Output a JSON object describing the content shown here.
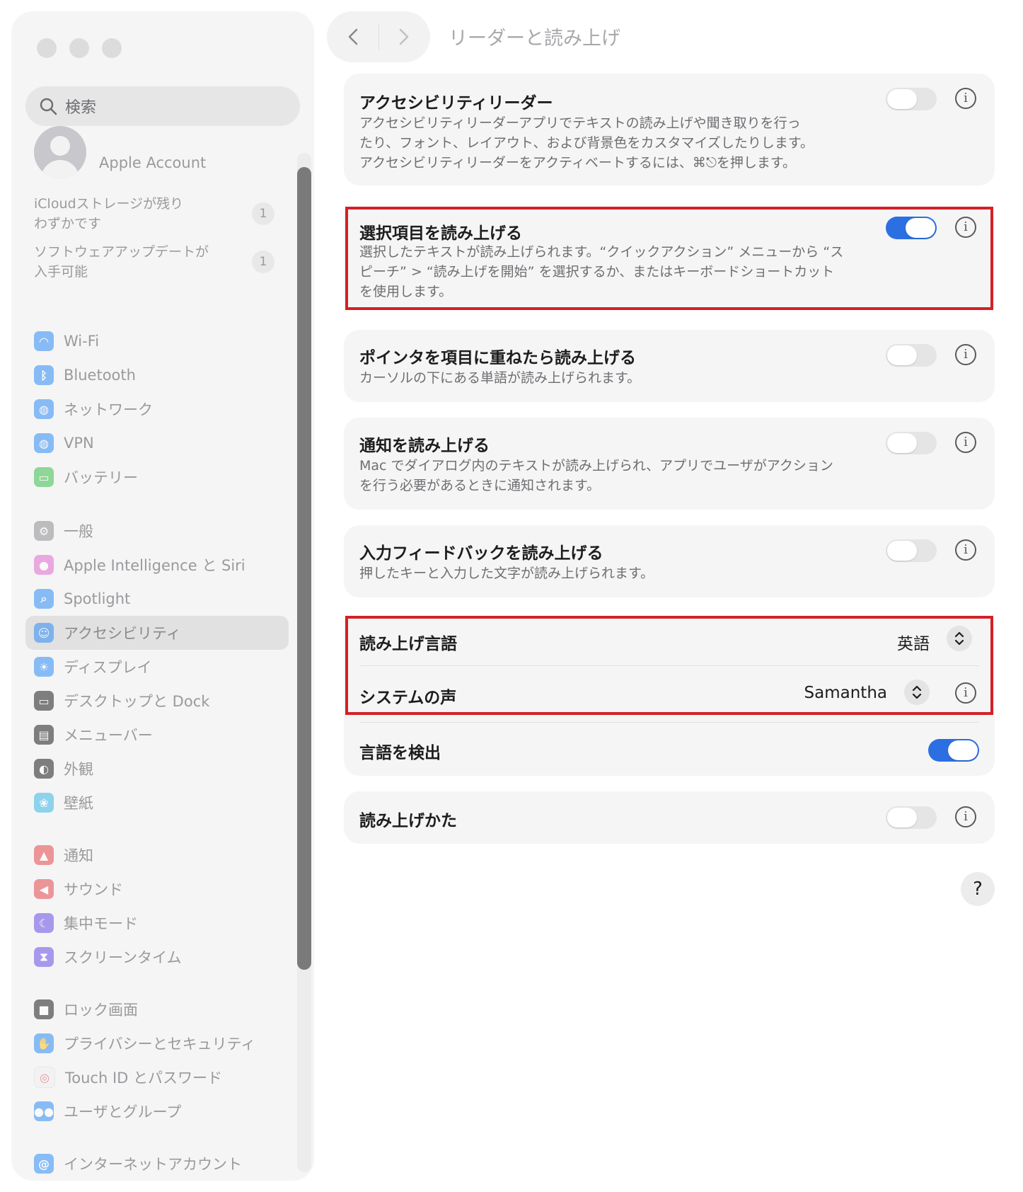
{
  "window": {
    "title": "リーダーと読み上げ"
  },
  "sidebar": {
    "search_placeholder": "検索",
    "account_name": "Apple Account",
    "notices": [
      {
        "label": "iCloudストレージが残り\nわずかです",
        "badge": "1"
      },
      {
        "label": "ソフトウェアアップデートが\n入手可能",
        "badge": "1"
      }
    ],
    "items": [
      {
        "label": "Wi-Fi",
        "icon": "wifi-icon",
        "color": "#2f8cf6"
      },
      {
        "label": "Bluetooth",
        "icon": "bluetooth-icon",
        "color": "#2f8cf6"
      },
      {
        "label": "ネットワーク",
        "icon": "globe-icon",
        "color": "#2f8cf6"
      },
      {
        "label": "VPN",
        "icon": "vpn-globe-icon",
        "color": "#2f8cf6"
      },
      {
        "label": "バッテリー",
        "icon": "battery-icon",
        "color": "#3bbf4c"
      },
      {
        "label": "一般",
        "icon": "gear-icon",
        "color": "#8e8e93"
      },
      {
        "label": "Apple Intelligence と Siri",
        "icon": "siri-icon",
        "color": "#e06bd0"
      },
      {
        "label": "Spotlight",
        "icon": "spotlight-search-icon",
        "color": "#2f8cf6"
      },
      {
        "label": "アクセシビリティ",
        "icon": "accessibility-icon",
        "color": "#2f8cf6"
      },
      {
        "label": "ディスプレイ",
        "icon": "sun-icon",
        "color": "#2f8cf6"
      },
      {
        "label": "デスクトップと Dock",
        "icon": "dock-icon",
        "color": "#1d1d1f"
      },
      {
        "label": "メニューバー",
        "icon": "menubar-icon",
        "color": "#1d1d1f"
      },
      {
        "label": "外観",
        "icon": "appearance-icon",
        "color": "#1d1d1f"
      },
      {
        "label": "壁紙",
        "icon": "wallpaper-flower-icon",
        "color": "#3ab7e6"
      },
      {
        "label": "通知",
        "icon": "bell-icon",
        "color": "#e5484d"
      },
      {
        "label": "サウンド",
        "icon": "speaker-icon",
        "color": "#e5484d"
      },
      {
        "label": "集中モード",
        "icon": "moon-icon",
        "color": "#6a4de6"
      },
      {
        "label": "スクリーンタイム",
        "icon": "hourglass-icon",
        "color": "#6a4de6"
      },
      {
        "label": "ロック画面",
        "icon": "lock-icon",
        "color": "#1d1d1f"
      },
      {
        "label": "プライバシーとセキュリティ",
        "icon": "hand-icon",
        "color": "#2f8cf6"
      },
      {
        "label": "Touch ID とパスワード",
        "icon": "fingerprint-icon",
        "color": "#f0f0f0"
      },
      {
        "label": "ユーザとグループ",
        "icon": "users-icon",
        "color": "#2f8cf6"
      },
      {
        "label": "インターネットアカウント",
        "icon": "at-icon",
        "color": "#2f8cf6"
      }
    ]
  },
  "content": {
    "reader": {
      "title": "アクセシビリティリーダー",
      "desc": "アクセシビリティリーダーアプリでテキストの読み上げや聞き取りを行っ\nたり、フォント、レイアウト、および背景色をカスタマイズしたりします。\nアクセシビリティリーダーをアクティベートするには、⌘⎋を押します。",
      "on": false
    },
    "speak_selection": {
      "title": "選択項目を読み上げる",
      "desc": "選択したテキストが読み上げられます。“クイックアクション” メニューから “ス\nピーチ” > “読み上げを開始” を選択するか、またはキーボードショートカット\nを使用します。",
      "on": true
    },
    "speak_pointer": {
      "title": "ポインタを項目に重ねたら読み上げる",
      "desc": "カーソルの下にある単語が読み上げられます。",
      "on": false
    },
    "speak_notifications": {
      "title": "通知を読み上げる",
      "desc": "Mac でダイアログ内のテキストが読み上げられ、アプリでユーザがアクション\nを行う必要があるときに通知されます。",
      "on": false
    },
    "typing_feedback": {
      "title": "入力フィードバックを読み上げる",
      "desc": "押したキーと入力した文字が読み上げられます。",
      "on": false
    },
    "speech_language": {
      "label": "読み上げ言語",
      "value": "英語"
    },
    "system_voice": {
      "label": "システムの声",
      "value": "Samantha"
    },
    "detect_language": {
      "label": "言語を検出",
      "on": true
    },
    "speaking_style": {
      "label": "読み上げかた",
      "on": false
    },
    "help_label": "?"
  },
  "colors": {
    "accent": "#2b6fe3",
    "highlight": "#d32027"
  }
}
